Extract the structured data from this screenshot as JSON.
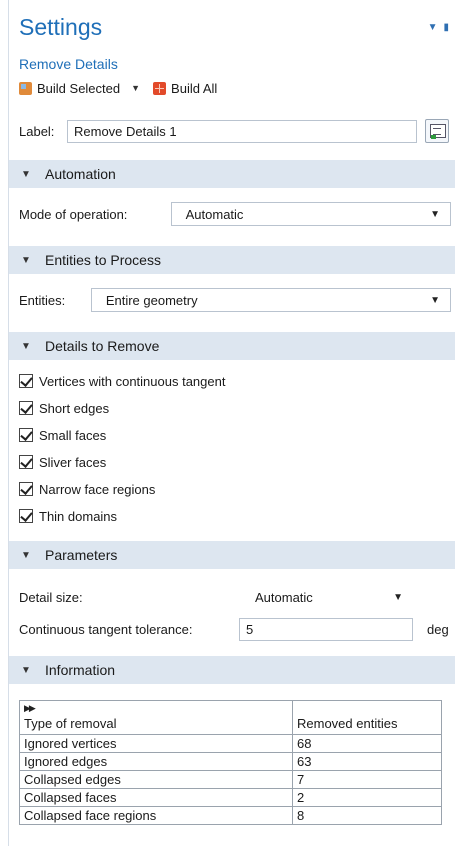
{
  "header": {
    "title": "Settings",
    "subtitle": "Remove Details"
  },
  "toolbar": {
    "build_selected": "Build Selected",
    "build_all": "Build All"
  },
  "label_row": {
    "label": "Label:",
    "value": "Remove Details 1"
  },
  "automation": {
    "section": "Automation",
    "mode_label": "Mode of operation:",
    "mode_value": "Automatic"
  },
  "entities": {
    "section": "Entities to Process",
    "label": "Entities:",
    "value": "Entire geometry"
  },
  "details": {
    "section": "Details to Remove",
    "items": [
      "Vertices with continuous tangent",
      "Short edges",
      "Small faces",
      "Sliver faces",
      "Narrow face regions",
      "Thin domains"
    ]
  },
  "parameters": {
    "section": "Parameters",
    "detail_size_label": "Detail size:",
    "detail_size_value": "Automatic",
    "tolerance_label": "Continuous tangent tolerance:",
    "tolerance_value": "5",
    "tolerance_unit": "deg"
  },
  "information": {
    "section": "Information",
    "columns": [
      "Type of removal",
      "Removed entities"
    ],
    "rows": [
      [
        "Ignored vertices",
        "68"
      ],
      [
        "Ignored edges",
        "63"
      ],
      [
        "Collapsed edges",
        "7"
      ],
      [
        "Collapsed faces",
        "2"
      ],
      [
        "Collapsed face regions",
        "8"
      ]
    ]
  }
}
